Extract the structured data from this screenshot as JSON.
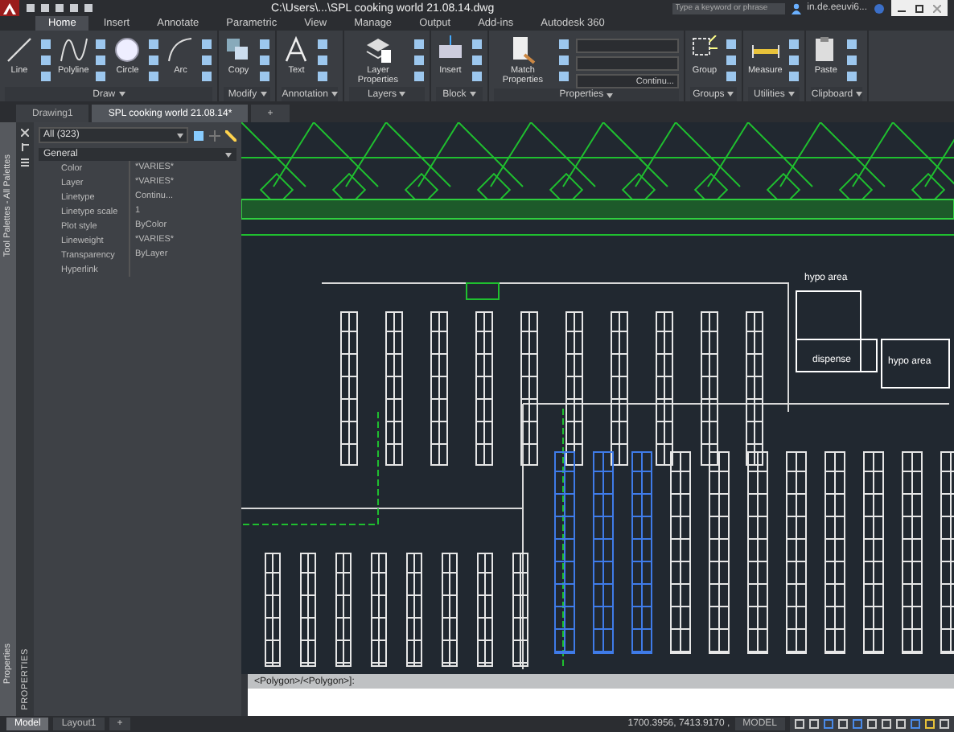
{
  "window": {
    "title": "C:\\Users\\...\\SPL cooking world 21.08.14.dwg",
    "search": {
      "placeholder": "Type a keyword or phrase"
    },
    "account": "in.de.eeuvi6..."
  },
  "ribbon": {
    "tabs": [
      {
        "label": "Home",
        "selected": true
      },
      {
        "label": "Insert",
        "selected": false
      },
      {
        "label": "Annotate",
        "selected": false
      },
      {
        "label": "Parametric",
        "selected": false
      },
      {
        "label": "View",
        "selected": false
      },
      {
        "label": "Manage",
        "selected": false
      },
      {
        "label": "Output",
        "selected": false
      },
      {
        "label": "Add-ins",
        "selected": false
      },
      {
        "label": "Autodesk 360",
        "selected": false
      }
    ],
    "groups": [
      {
        "label": "Draw",
        "tools": [
          {
            "kind": "line",
            "label": "Line"
          },
          {
            "kind": "polyline",
            "label": "Polyline"
          },
          {
            "kind": "circle",
            "label": "Circle"
          },
          {
            "kind": "arc",
            "label": "Arc"
          }
        ]
      },
      {
        "label": "Modify",
        "tools": [
          {
            "kind": "copy",
            "label": "Copy"
          }
        ]
      },
      {
        "label": "Annotation",
        "tools": [
          {
            "kind": "text",
            "label": "Text"
          }
        ]
      },
      {
        "label": "Layers",
        "tools": [
          {
            "kind": "layer",
            "label": "Layer Properties"
          }
        ]
      },
      {
        "label": "Block",
        "tools": [
          {
            "kind": "insert",
            "label": "Insert"
          }
        ]
      },
      {
        "label": "Properties",
        "tools": [
          {
            "kind": "match",
            "label": "Match Properties"
          }
        ],
        "linetype": "Continu..."
      },
      {
        "label": "Groups",
        "tools": [
          {
            "kind": "group",
            "label": "Group"
          }
        ]
      },
      {
        "label": "Utilities",
        "tools": [
          {
            "kind": "measure",
            "label": "Measure"
          }
        ]
      },
      {
        "label": "Clipboard",
        "tools": [
          {
            "kind": "paste",
            "label": "Paste"
          }
        ]
      }
    ]
  },
  "document_tabs": [
    {
      "label": "Drawing1",
      "selected": false
    },
    {
      "label": "SPL cooking world 21.08.14*",
      "selected": true
    }
  ],
  "new_tab": "+",
  "side_palettes": [
    {
      "label": "Tool Palettes - All Palettes"
    },
    {
      "label": "Properties"
    }
  ],
  "properties": {
    "title": "PROPERTIES",
    "selection": "All (323)",
    "section": "General",
    "rows": [
      {
        "name": "Color",
        "value": "*VARIES*"
      },
      {
        "name": "Layer",
        "value": "*VARIES*"
      },
      {
        "name": "Linetype",
        "value": "Continu..."
      },
      {
        "name": "Linetype scale",
        "value": "1"
      },
      {
        "name": "Plot style",
        "value": "ByColor"
      },
      {
        "name": "Lineweight",
        "value": "*VARIES*"
      },
      {
        "name": "Transparency",
        "value": "ByLayer"
      },
      {
        "name": "Hyperlink"
      }
    ]
  },
  "drawing": {
    "labels": [
      "hypo area",
      "dispense",
      "hypo area"
    ]
  },
  "command_line": {
    "text": "<Polygon>/<Polygon>]:"
  },
  "status_bar": {
    "layouts": [
      {
        "label": "Model",
        "selected": true
      },
      {
        "label": "Layout1",
        "selected": false
      }
    ],
    "add": "+",
    "coordinates": "1700.3956, 7413.9170 ,",
    "space": "MODEL"
  }
}
